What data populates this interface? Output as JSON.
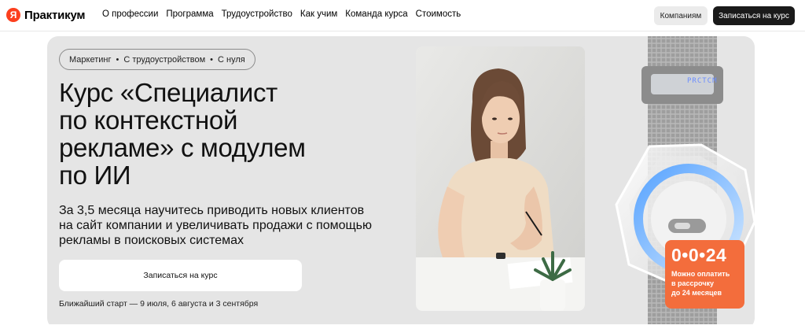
{
  "header": {
    "logo_mark": "Я",
    "logo_text": "Практикум",
    "nav": [
      "О профессии",
      "Программа",
      "Трудоустройство",
      "Как учим",
      "Команда курса",
      "Стоимость"
    ],
    "companies_button": "Компаниям",
    "enroll_button": "Записаться на курс"
  },
  "hero": {
    "tags": [
      "Маркетинг",
      "С трудоустройством",
      "С нуля"
    ],
    "tag_separator": "•",
    "title_lines": [
      "Курс «Специалист",
      "по контекстной",
      "рекламе» с модулем",
      "по ИИ"
    ],
    "subtitle_lines": [
      "За 3,5 месяца научитесь приводить новых клиентов",
      "на сайт компании и увеличивать продажи с помощью",
      "рекламы в поисковых системах"
    ],
    "cta_label": "Записаться на курс",
    "start_text": "Ближайший старт — 9 июля, 6 августа и 3 сентября"
  },
  "device": {
    "screen_text": "PRCTCM"
  },
  "badge": {
    "time": "0•0•24",
    "note_lines": [
      "Можно оплатить",
      "в рассрочку",
      "до 24 месяцев"
    ]
  },
  "colors": {
    "accent": "#fc3f1d",
    "badge": "#f36d3c",
    "hero_bg": "#e5e5e5",
    "dark_button": "#1a1a1a"
  }
}
